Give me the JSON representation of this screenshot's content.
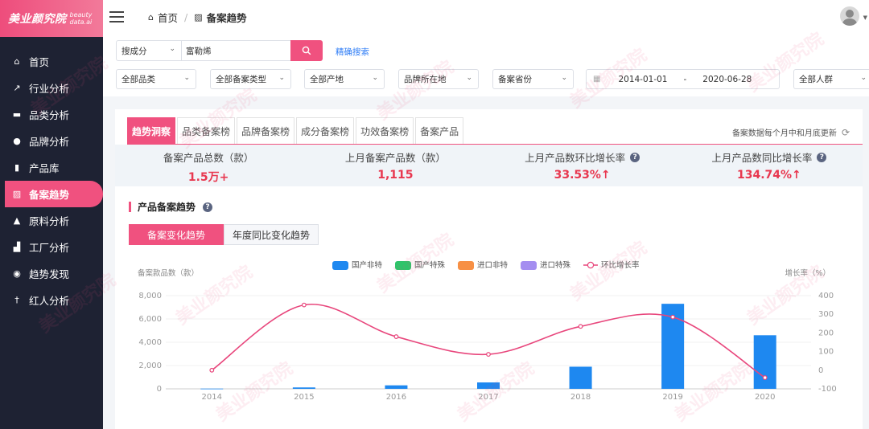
{
  "brand": {
    "name_cn": "美业颜究院",
    "name_en_1": "beauty",
    "name_en_2": "data.ai"
  },
  "sidebar": {
    "items": [
      {
        "label": "首页",
        "icon": "home-icon",
        "glyph": "⌂"
      },
      {
        "label": "行业分析",
        "icon": "trend-icon",
        "glyph": "↗"
      },
      {
        "label": "品类分析",
        "icon": "briefcase-icon",
        "glyph": "▬"
      },
      {
        "label": "品牌分析",
        "icon": "user-icon",
        "glyph": "●"
      },
      {
        "label": "产品库",
        "icon": "file-icon",
        "glyph": "▮"
      },
      {
        "label": "备案趋势",
        "icon": "chart-box-icon",
        "glyph": "▨",
        "active": true
      },
      {
        "label": "原料分析",
        "icon": "flask-icon",
        "glyph": "▲"
      },
      {
        "label": "工厂分析",
        "icon": "factory-icon",
        "glyph": "▟"
      },
      {
        "label": "趋势发现",
        "icon": "compass-icon",
        "glyph": "◉"
      },
      {
        "label": "红人分析",
        "icon": "person-icon",
        "glyph": "†"
      }
    ]
  },
  "breadcrumb": {
    "home": "首页",
    "current": "备案趋势"
  },
  "filters": {
    "search_type": "搜成分",
    "search_value": "富勒烯",
    "precise_search": "精确搜索",
    "category": "全部品类",
    "record_type": "全部备案类型",
    "origin": "全部产地",
    "brand_location": "品牌所在地",
    "record_province": "备案省份",
    "date_from": "2014-01-01",
    "date_to": "2020-06-28",
    "date_sep": "-",
    "audience": "全部人群"
  },
  "tabs": [
    "趋势洞察",
    "品类备案榜",
    "品牌备案榜",
    "成分备案榜",
    "功效备案榜",
    "备案产品"
  ],
  "update_note": "备案数据每个月中和月底更新",
  "stats": [
    {
      "label": "备案产品总数（款）",
      "value": "1.5万+",
      "help": false
    },
    {
      "label": "上月备案产品数（款）",
      "value": "1,115",
      "help": false
    },
    {
      "label": "上月产品数环比增长率",
      "value": "33.53%↑",
      "help": true
    },
    {
      "label": "上月产品数同比增长率",
      "value": "134.74%↑",
      "help": true
    }
  ],
  "section_title": "产品备案趋势",
  "subtabs": [
    "备案变化趋势",
    "年度同比变化趋势"
  ],
  "chart_data": {
    "type": "bar",
    "categories": [
      "2014",
      "2015",
      "2016",
      "2017",
      "2018",
      "2019",
      "2020"
    ],
    "series": [
      {
        "name": "国产非特",
        "type": "bar",
        "color": "#1e88f0",
        "values": [
          20,
          120,
          300,
          550,
          1900,
          7300,
          4600
        ]
      },
      {
        "name": "国产特殊",
        "type": "bar",
        "color": "#2ec46a",
        "values": [
          0,
          0,
          0,
          0,
          0,
          0,
          0
        ]
      },
      {
        "name": "进口非特",
        "type": "bar",
        "color": "#f79045",
        "values": [
          0,
          0,
          0,
          0,
          0,
          0,
          0
        ]
      },
      {
        "name": "进口特殊",
        "type": "bar",
        "color": "#a48ef0",
        "values": [
          0,
          0,
          0,
          0,
          0,
          0,
          0
        ]
      },
      {
        "name": "环比增长率",
        "type": "line",
        "axis": "right",
        "color": "#e8467c",
        "values": [
          0,
          350,
          180,
          85,
          235,
          285,
          -40
        ]
      }
    ],
    "ylabel": "备案款品数（款）",
    "ylabel_right": "增长率（%）",
    "yticks": [
      "8,000",
      "6,000",
      "4,000",
      "2,000",
      "0"
    ],
    "yticks_right": [
      "400",
      "300",
      "200",
      "100",
      "0",
      "-100"
    ],
    "ylim": [
      0,
      8000
    ],
    "ylim_right": [
      -100,
      400
    ],
    "legend_position": "top-center",
    "grid": true
  },
  "watermark_text": "美业颜究院"
}
